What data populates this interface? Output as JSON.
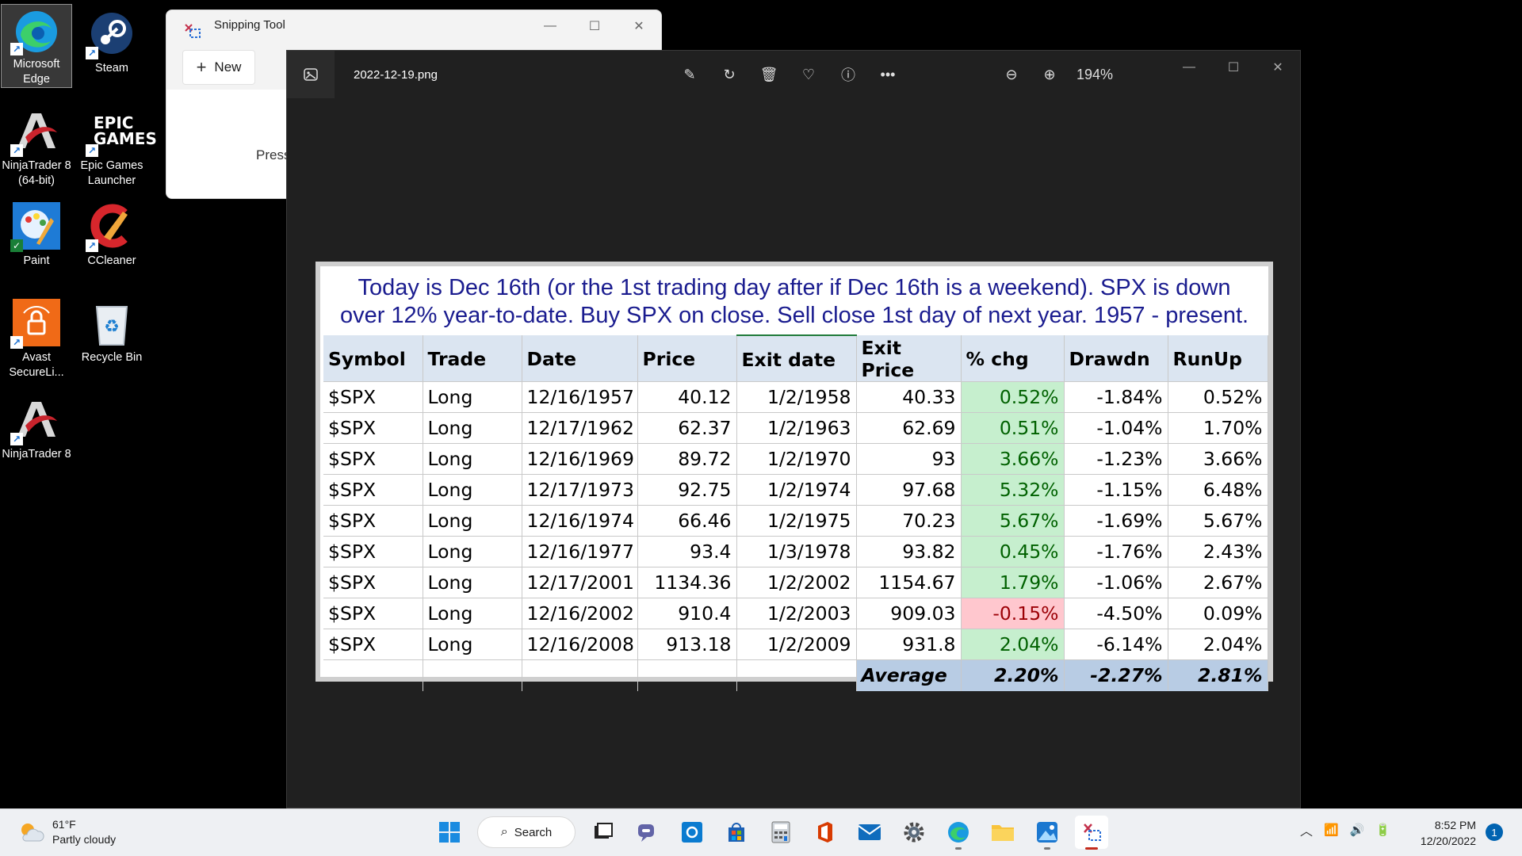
{
  "desktop": {
    "icons": [
      {
        "label": "Microsoft Edge",
        "icon": "edge-icon"
      },
      {
        "label": "Steam",
        "icon": "steam-icon"
      },
      {
        "label": "NinjaTrader 8 (64-bit)",
        "icon": "ninjatrader-icon"
      },
      {
        "label": "Epic Games Launcher",
        "icon": "epic-games-icon"
      },
      {
        "label": "Paint",
        "icon": "paint-icon"
      },
      {
        "label": "CCleaner",
        "icon": "ccleaner-icon"
      },
      {
        "label": "Avast SecureLi...",
        "icon": "avast-icon"
      },
      {
        "label": "Recycle Bin",
        "icon": "recycle-bin-icon"
      },
      {
        "label": "NinjaTrader 8",
        "icon": "ninjatrader-icon"
      }
    ],
    "epic_logo_text": "EPIC GAMES"
  },
  "snipping_tool": {
    "title": "Snipping Tool",
    "new_label": "New",
    "press_text": "Press"
  },
  "photos": {
    "filename": "2022-12-19.png",
    "zoom": "194%",
    "image": {
      "caption_line1": "Today is Dec 16th (or the 1st trading day after if Dec 16th is a weekend). SPX is down",
      "caption_line2": "over 12% year-to-date. Buy SPX on close. Sell close 1st day of next year. 1957 - present.",
      "headers": [
        "Symbol",
        "Trade",
        "Date",
        "Price",
        "Exit date",
        "Exit Price",
        "% chg",
        "Drawdn",
        "RunUp"
      ],
      "rows": [
        [
          "$SPX",
          "Long",
          "12/16/1957",
          "40.12",
          "1/2/1958",
          "40.33",
          "0.52%",
          "-1.84%",
          "0.52%"
        ],
        [
          "$SPX",
          "Long",
          "12/17/1962",
          "62.37",
          "1/2/1963",
          "62.69",
          "0.51%",
          "-1.04%",
          "1.70%"
        ],
        [
          "$SPX",
          "Long",
          "12/16/1969",
          "89.72",
          "1/2/1970",
          "93",
          "3.66%",
          "-1.23%",
          "3.66%"
        ],
        [
          "$SPX",
          "Long",
          "12/17/1973",
          "92.75",
          "1/2/1974",
          "97.68",
          "5.32%",
          "-1.15%",
          "6.48%"
        ],
        [
          "$SPX",
          "Long",
          "12/16/1974",
          "66.46",
          "1/2/1975",
          "70.23",
          "5.67%",
          "-1.69%",
          "5.67%"
        ],
        [
          "$SPX",
          "Long",
          "12/16/1977",
          "93.4",
          "1/3/1978",
          "93.82",
          "0.45%",
          "-1.76%",
          "2.43%"
        ],
        [
          "$SPX",
          "Long",
          "12/17/2001",
          "1134.36",
          "1/2/2002",
          "1154.67",
          "1.79%",
          "-1.06%",
          "2.67%"
        ],
        [
          "$SPX",
          "Long",
          "12/16/2002",
          "910.4",
          "1/2/2003",
          "909.03",
          "-0.15%",
          "-4.50%",
          "0.09%"
        ],
        [
          "$SPX",
          "Long",
          "12/16/2008",
          "913.18",
          "1/2/2009",
          "931.8",
          "2.04%",
          "-6.14%",
          "2.04%"
        ]
      ],
      "average_label": "Average",
      "average_values": [
        "2.20%",
        "-2.27%",
        "2.81%"
      ]
    }
  },
  "taskbar": {
    "weather_temp": "61°F",
    "weather_desc": "Partly cloudy",
    "search_label": "Search",
    "time": "8:52 PM",
    "date": "12/20/2022",
    "notification_count": "1"
  }
}
